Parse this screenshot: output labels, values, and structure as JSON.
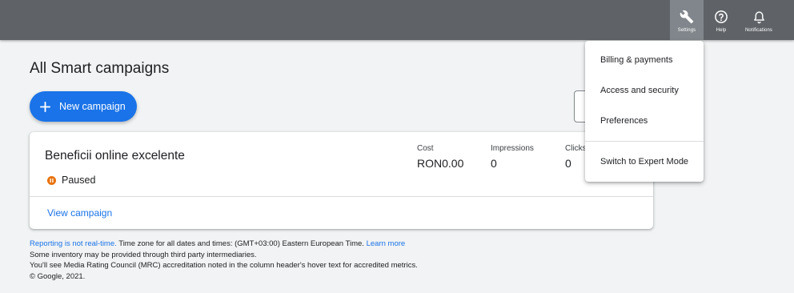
{
  "topbar": {
    "buttons": [
      {
        "label": "Settings",
        "icon": "wrench-icon",
        "active": true
      },
      {
        "label": "Help",
        "icon": "help-icon"
      },
      {
        "label": "Notifications",
        "icon": "bell-icon"
      }
    ],
    "bg_color": "#5f6368",
    "active_color": "#80868b"
  },
  "page": {
    "title": "All Smart campaigns",
    "new_campaign_label": "New campaign"
  },
  "campaign": {
    "name": "Beneficii online excelente",
    "status": "Paused",
    "status_color": "#e8710a",
    "metrics": [
      {
        "label": "Cost",
        "value": "RON0.00"
      },
      {
        "label": "Impressions",
        "value": "0"
      },
      {
        "label": "Clicks",
        "value": "0"
      }
    ],
    "view_link": "View campaign"
  },
  "footer": {
    "line1_link": "Reporting is not real-time.",
    "line1_text": " Time zone for all dates and times: (GMT+03:00) Eastern European Time. ",
    "line1_link2": "Learn more",
    "line2": "Some inventory may be provided through third party intermediaries.",
    "line3": "You'll see Media Rating Council (MRC) accreditation noted in the column header's hover text for accredited metrics.",
    "line4": "© Google, 2021."
  },
  "settings_menu": {
    "items": [
      "Billing & payments",
      "Access and security",
      "Preferences"
    ],
    "footer_item": "Switch to Expert Mode"
  },
  "accent_color": "#1a73e8"
}
